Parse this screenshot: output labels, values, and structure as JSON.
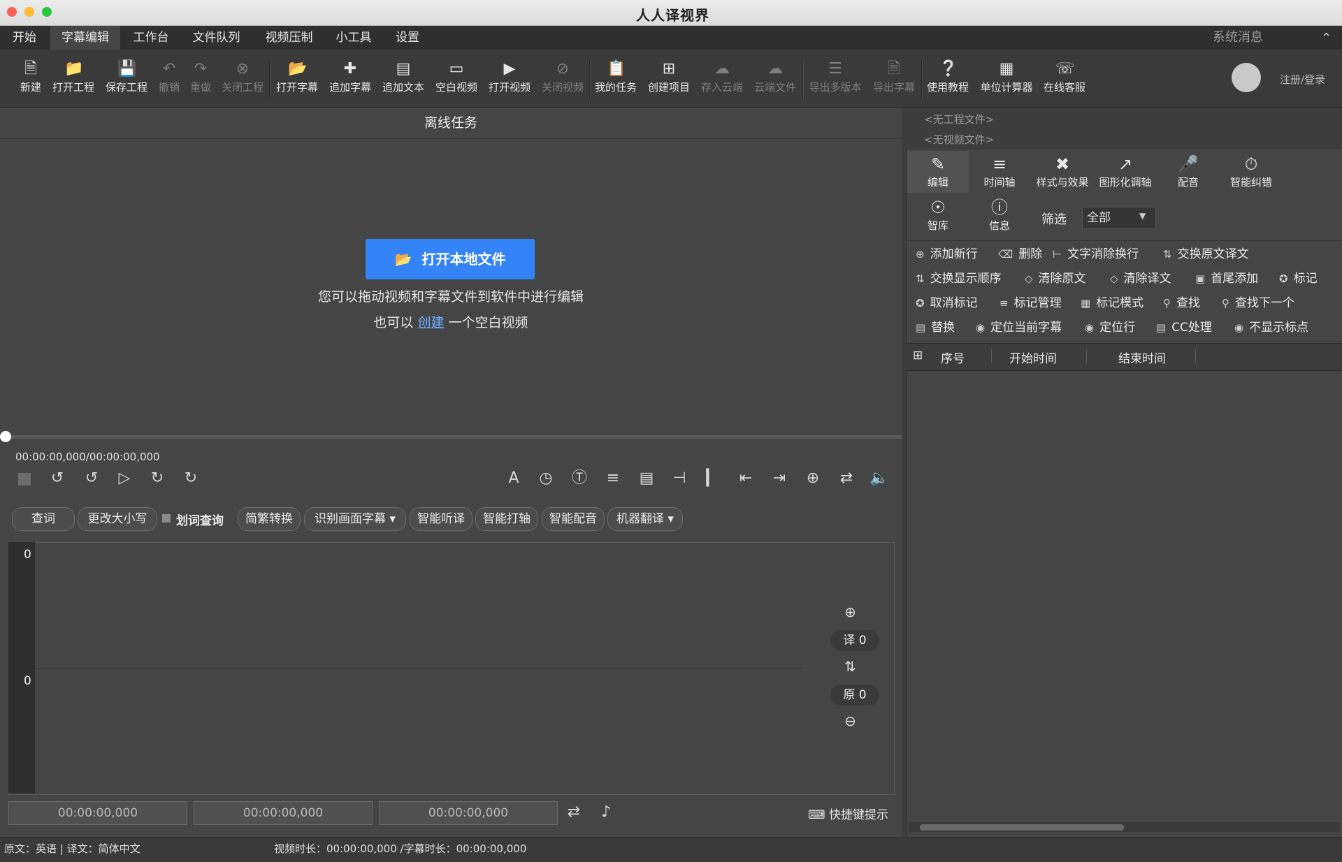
{
  "app": {
    "title_logo": "人人译视界"
  },
  "menubar": {
    "items": [
      "开始",
      "字幕编辑",
      "工作台",
      "文件队列",
      "视频压制",
      "小工具",
      "设置"
    ],
    "active": "字幕编辑",
    "system_message": "系统消息"
  },
  "toolbar": {
    "new": "新建",
    "open_project": "打开工程",
    "save_project": "保存工程",
    "undo": "撤销",
    "redo": "重做",
    "close_project": "关闭工程",
    "open_subtitle": "打开字幕",
    "append_subtitle": "追加字幕",
    "append_text": "追加文本",
    "blank_video": "空白视频",
    "open_video": "打开视频",
    "close_video": "关闭视频",
    "my_tasks": "我的任务",
    "create_project": "创建项目",
    "save_cloud": "存入云端",
    "cloud_files": "云端文件",
    "export_multi": "导出多版本",
    "export_subtitle": "导出字幕",
    "tutorial": "使用教程",
    "unit_calc": "单位计算器",
    "support": "在线客服",
    "login": "注册/登录"
  },
  "left": {
    "panel_title": "离线任务",
    "open_local_button": "打开本地文件",
    "hint_line1": "您可以拖动视频和字幕文件到软件中进行编辑",
    "hint_prefix": "也可以",
    "hint_link": "创建",
    "hint_suffix": "一个空白视频",
    "timecode": "00:00:00,000/00:00:00,000",
    "progress": 0
  },
  "tools": {
    "lookup": "查词",
    "change_case": "更改大小写",
    "word_lookup": "划词查询",
    "convert_trad_simp": "简繁转换",
    "recognize_subs": "识别画面字幕",
    "smart_listen": "智能听译",
    "smart_axis": "智能打轴",
    "smart_dub": "智能配音",
    "machine_translate": "机器翻译"
  },
  "wave": {
    "lane1_num": "0",
    "lane2_num": "0",
    "translation_count": "译 0",
    "original_count": "原 0"
  },
  "time_fields": [
    "00:00:00,000",
    "00:00:00,000",
    "00:00:00,000"
  ],
  "shortcut_hint": "快捷键提示",
  "right": {
    "no_project": "<无工程文件>",
    "no_video": "<无视频文件>",
    "tabs": [
      "编辑",
      "时间轴",
      "样式与效果",
      "图形化调轴",
      "配音",
      "智能纠错",
      "智库",
      "信息"
    ],
    "active_tab": "编辑",
    "filter_label": "筛选",
    "filter_value": "全部",
    "actions": [
      "添加新行",
      "删除",
      "文字消除换行",
      "交换原文译文",
      "交换显示顺序",
      "清除原文",
      "清除译文",
      "首尾添加",
      "标记",
      "取消标记",
      "标记管理",
      "标记模式",
      "查找",
      "查找下一个",
      "替换",
      "定位当前字幕",
      "定位行",
      "CC处理",
      "不显示标点"
    ],
    "columns": [
      "序号",
      "开始时间",
      "结束时间"
    ]
  },
  "status": {
    "lang": "原文：英语 | 译文：简体中文",
    "durations": "视频时长：00:00:00,000 /字幕时长：00:00:00,000"
  },
  "colors": {
    "accent": "#3584f7",
    "link": "#6fb0ff",
    "bg": "#454545"
  }
}
